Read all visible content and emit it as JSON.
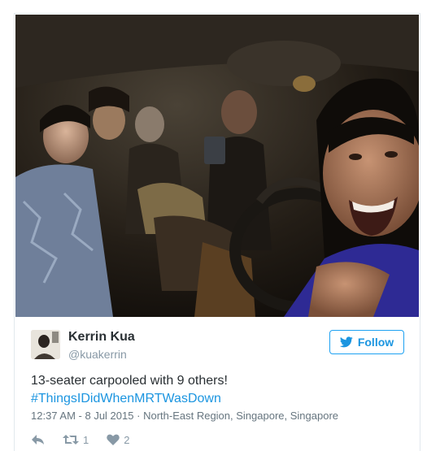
{
  "tweet": {
    "author_name": "Kerrin Kua",
    "author_handle": "@kuakerrin",
    "follow_label": "Follow",
    "text": "13-seater carpooled with 9 others!",
    "hashtag": "#ThingsIDidWhenMRTWasDown",
    "timestamp": "12:37 AM - 8 Jul 2015",
    "separator": "·",
    "location": "North-East Region, Singapore, Singapore",
    "retweet_count": "1",
    "like_count": "2"
  },
  "icons": {
    "follow": "bird-icon",
    "reply": "reply-arrow-icon",
    "retweet": "retweet-icon",
    "like": "heart-icon"
  },
  "colors": {
    "link": "#1b95e0",
    "follow_border": "#1da1f2",
    "muted": "#8899a6",
    "meta": "#66757f",
    "text": "#292f33",
    "card_border": "#e1e8ed"
  }
}
